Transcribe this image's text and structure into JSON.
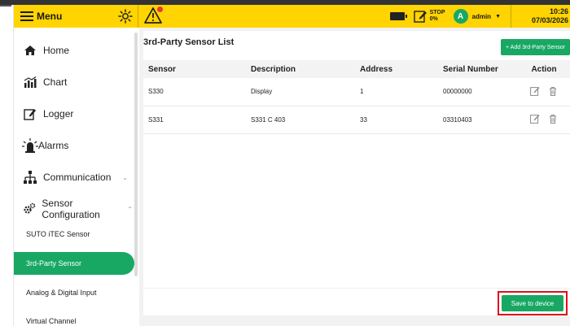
{
  "header": {
    "menu_label": "Menu",
    "stop_line1": "STOP",
    "stop_line2": "0%",
    "user_initial": "A",
    "user_name": "admin",
    "time": "10:26",
    "date": "07/03/2026"
  },
  "sidebar": {
    "items": [
      {
        "label": "Home",
        "icon": "home-icon"
      },
      {
        "label": "Chart",
        "icon": "chart-icon"
      },
      {
        "label": "Logger",
        "icon": "logger-icon"
      },
      {
        "label": "Alarms",
        "icon": "alarm-icon"
      },
      {
        "label": "Communication",
        "icon": "network-icon"
      },
      {
        "label": "Sensor Configuration",
        "icon": "gear-icon"
      }
    ],
    "sub_items": [
      {
        "label": "SUTO iTEC Sensor"
      },
      {
        "label": "3rd-Party Sensor"
      },
      {
        "label": "Analog & Digital Input"
      },
      {
        "label": "Virtual Channel"
      }
    ]
  },
  "main": {
    "title": "3rd-Party Sensor List",
    "add_button": "+ Add 3rd-Party Sensor",
    "columns": [
      "Sensor",
      "Description",
      "Address",
      "Serial Number",
      "Action"
    ],
    "rows": [
      {
        "sensor": "S330",
        "description": "Display",
        "address": "1",
        "serial": "00000000"
      },
      {
        "sensor": "S331",
        "description": "S331 C 403",
        "address": "33",
        "serial": "03310403"
      }
    ],
    "save_button": "Save to device"
  },
  "colors": {
    "header_yellow": "#ffd400",
    "accent_green": "#18a864",
    "highlight_red": "#e0101a"
  }
}
